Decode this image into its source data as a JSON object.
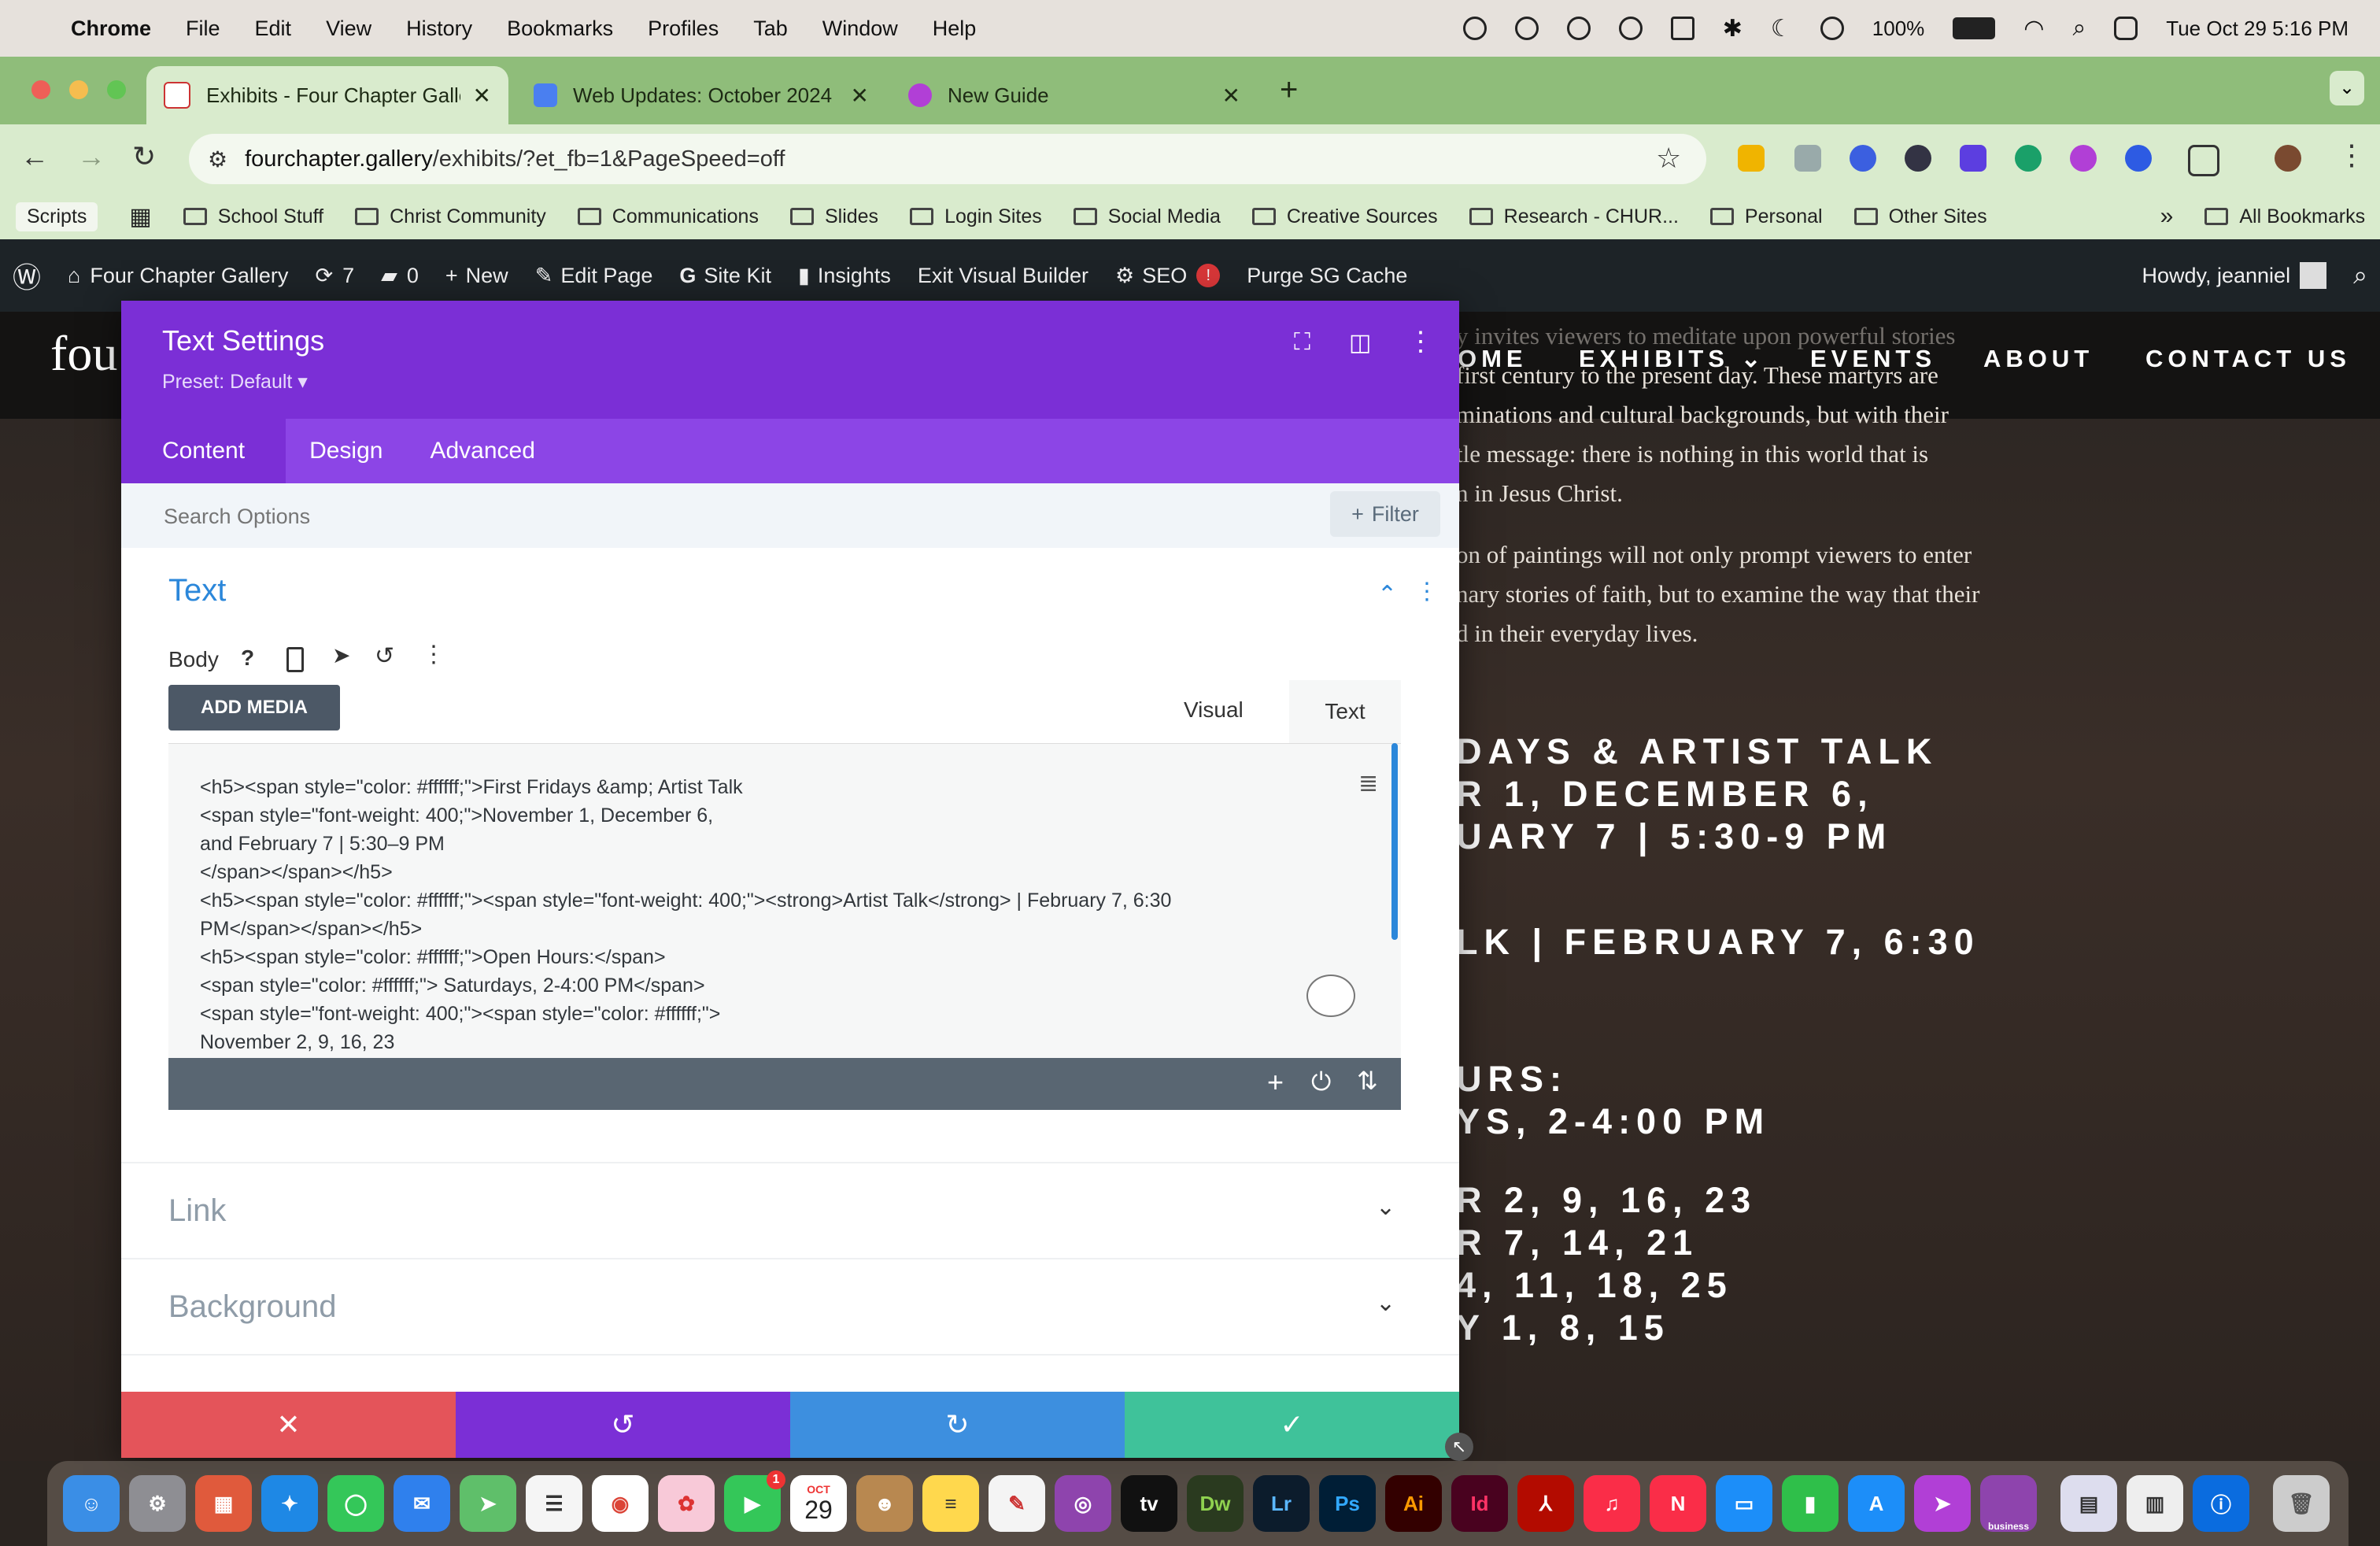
{
  "menubar": {
    "app": "Chrome",
    "items": [
      "File",
      "Edit",
      "View",
      "History",
      "Bookmarks",
      "Profiles",
      "Tab",
      "Window",
      "Help"
    ],
    "battery": "100%",
    "datetime": "Tue Oct 29  5:16 PM"
  },
  "tabs": [
    {
      "title": "Exhibits - Four Chapter Galler",
      "active": true,
      "icon": "gallery-favicon"
    },
    {
      "title": "Web Updates: October 2024",
      "active": false,
      "icon": "docs-favicon"
    },
    {
      "title": "New Guide",
      "active": false,
      "icon": "guide-favicon"
    }
  ],
  "url": {
    "host": "fourchapter.gallery",
    "path": "/exhibits/?et_fb=1&PageSpeed=off"
  },
  "bookmarks": [
    "Scripts",
    "School Stuff",
    "Christ Community",
    "Communications",
    "Slides",
    "Login Sites",
    "Social Media",
    "Creative Sources",
    "Research - CHUR...",
    "Personal",
    "Other Sites",
    "All Bookmarks"
  ],
  "wpbar": {
    "site": "Four Chapter Gallery",
    "updates": "7",
    "comments": "0",
    "new": "New",
    "edit": "Edit Page",
    "sitekit": "Site Kit",
    "insights": "Insights",
    "exit": "Exit Visual Builder",
    "seo": "SEO",
    "seo_badge": "!",
    "purge": "Purge SG Cache",
    "howdy": "Howdy, jeanniel"
  },
  "site": {
    "logo": "fou",
    "nav": [
      "OME",
      "EXHIBITS",
      "EVENTS",
      "ABOUT",
      "CONTACT US"
    ],
    "paragraph1": [
      "y invites viewers to meditate upon powerful stories",
      "first century to the present day. These martyrs are",
      "minations and cultural backgrounds, but with their",
      "tle message: there is nothing in this world that is",
      "n in Jesus Christ."
    ],
    "paragraph2": [
      "on of paintings will not only prompt viewers to enter",
      "nary stories of faith, but to examine the way that their",
      "d in their everyday lives."
    ],
    "headings": [
      "DAYS & ARTIST TALK",
      "R 1, DECEMBER 6,",
      "UARY 7 | 5:30-9 PM",
      "LK | FEBRUARY 7, 6:30",
      "URS:",
      "YS, 2-4:00 PM",
      "R 2, 9, 16, 23",
      "R 7, 14, 21",
      "4, 11, 18, 25",
      "Y 1, 8, 15"
    ]
  },
  "modal": {
    "title": "Text Settings",
    "preset": "Preset: Default",
    "tabs": [
      "Content",
      "Design",
      "Advanced"
    ],
    "search_placeholder": "Search Options",
    "filter": "Filter",
    "section_text": "Text",
    "body_label": "Body",
    "add_media": "ADD MEDIA",
    "editor_tabs": [
      "Visual",
      "Text"
    ],
    "code_lines": [
      "<h5><span style=\"color: #ffffff;\">First Fridays &amp; Artist Talk",
      "<span style=\"font-weight: 400;\">November 1, December 6,",
      "and February 7 | 5:30–9 PM",
      "</span></span></h5>",
      "<h5><span style=\"color: #ffffff;\"><span style=\"font-weight: 400;\"><strong>Artist Talk</strong> | February 7, 6:30",
      "PM</span></span></h5>",
      "<h5><span style=\"color: #ffffff;\">Open Hours:</span>",
      "<span style=\"color: #ffffff;\"> Saturdays, 2-4:00 PM</span>",
      "<span style=\"font-weight: 400;\"><span style=\"color: #ffffff;\">",
      "November 2, 9, 16, 23"
    ],
    "section_link": "Link",
    "section_background": "Background"
  },
  "colors": {
    "modal_purple": "#7b2fd6",
    "cancel": "#e4545a",
    "undo": "#7b2fd6",
    "redo": "#3d8fdf",
    "save": "#3fc29a"
  },
  "dock": {
    "calendar_month": "OCT",
    "calendar_day": "29",
    "mail_badge": "1",
    "dw": "Dw",
    "lr": "Lr",
    "ps": "Ps",
    "ai": "Ai",
    "id": "Id",
    "tv": "tv",
    "business": "business"
  }
}
